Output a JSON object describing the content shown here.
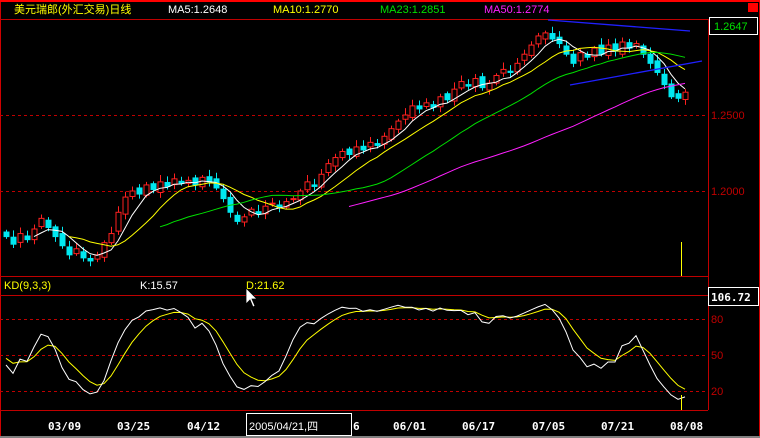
{
  "header": {
    "title": "美元瑞郎(外汇交易)日线",
    "ma5": "MA5:1.2648",
    "ma10": "MA10:1.2770",
    "ma23": "MA23:1.2851",
    "ma50": "MA50:1.2774",
    "last_price": "1.2647"
  },
  "kd_panel": {
    "title": "KD(9,3,3)",
    "k": "K:15.57",
    "d": "D:21.62",
    "cursor_value": "106.72"
  },
  "colors": {
    "up": "#ff2020",
    "down": "#00e8f0",
    "ma5": "#ffffff",
    "ma10": "#ffff00",
    "ma23": "#00e000",
    "ma50": "#ff20ff",
    "grid": "#c00000",
    "trend": "#2020ff"
  },
  "chart_data": {
    "type": "candlestick",
    "title": "美元瑞郎(外汇交易)日线",
    "price_ticks": [
      "1.2500",
      "1.2000"
    ],
    "kd_ticks": [
      "80",
      "50",
      "20"
    ],
    "date_labels": [
      "03/09",
      "03/25",
      "04/12",
      "6",
      "06/01",
      "06/17",
      "07/05",
      "07/21",
      "08/08"
    ],
    "cursor_date": "2005/04/21,四",
    "closes": [
      1.17,
      1.165,
      1.172,
      1.168,
      1.175,
      1.182,
      1.176,
      1.17,
      1.164,
      1.158,
      1.162,
      1.156,
      1.154,
      1.158,
      1.166,
      1.172,
      1.186,
      1.196,
      1.2,
      1.198,
      1.204,
      1.201,
      1.206,
      1.203,
      1.208,
      1.205,
      1.207,
      1.204,
      1.209,
      1.206,
      1.202,
      1.195,
      1.186,
      1.18,
      1.183,
      1.188,
      1.185,
      1.19,
      1.192,
      1.189,
      1.193,
      1.195,
      1.2,
      1.206,
      1.203,
      1.211,
      1.218,
      1.222,
      1.226,
      1.224,
      1.229,
      1.227,
      1.232,
      1.23,
      1.236,
      1.241,
      1.246,
      1.25,
      1.256,
      1.254,
      1.258,
      1.255,
      1.262,
      1.26,
      1.267,
      1.272,
      1.269,
      1.274,
      1.268,
      1.271,
      1.276,
      1.28,
      1.278,
      1.284,
      1.29,
      1.296,
      1.302,
      1.304,
      1.3,
      1.297,
      1.29,
      1.284,
      1.291,
      1.288,
      1.294,
      1.29,
      1.296,
      1.292,
      1.298,
      1.294,
      1.297,
      1.29,
      1.284,
      1.278,
      1.27,
      1.262,
      1.261,
      1.265
    ],
    "moving_averages": [
      5,
      10,
      23,
      50
    ],
    "kd_params": [
      9,
      3,
      3
    ]
  }
}
